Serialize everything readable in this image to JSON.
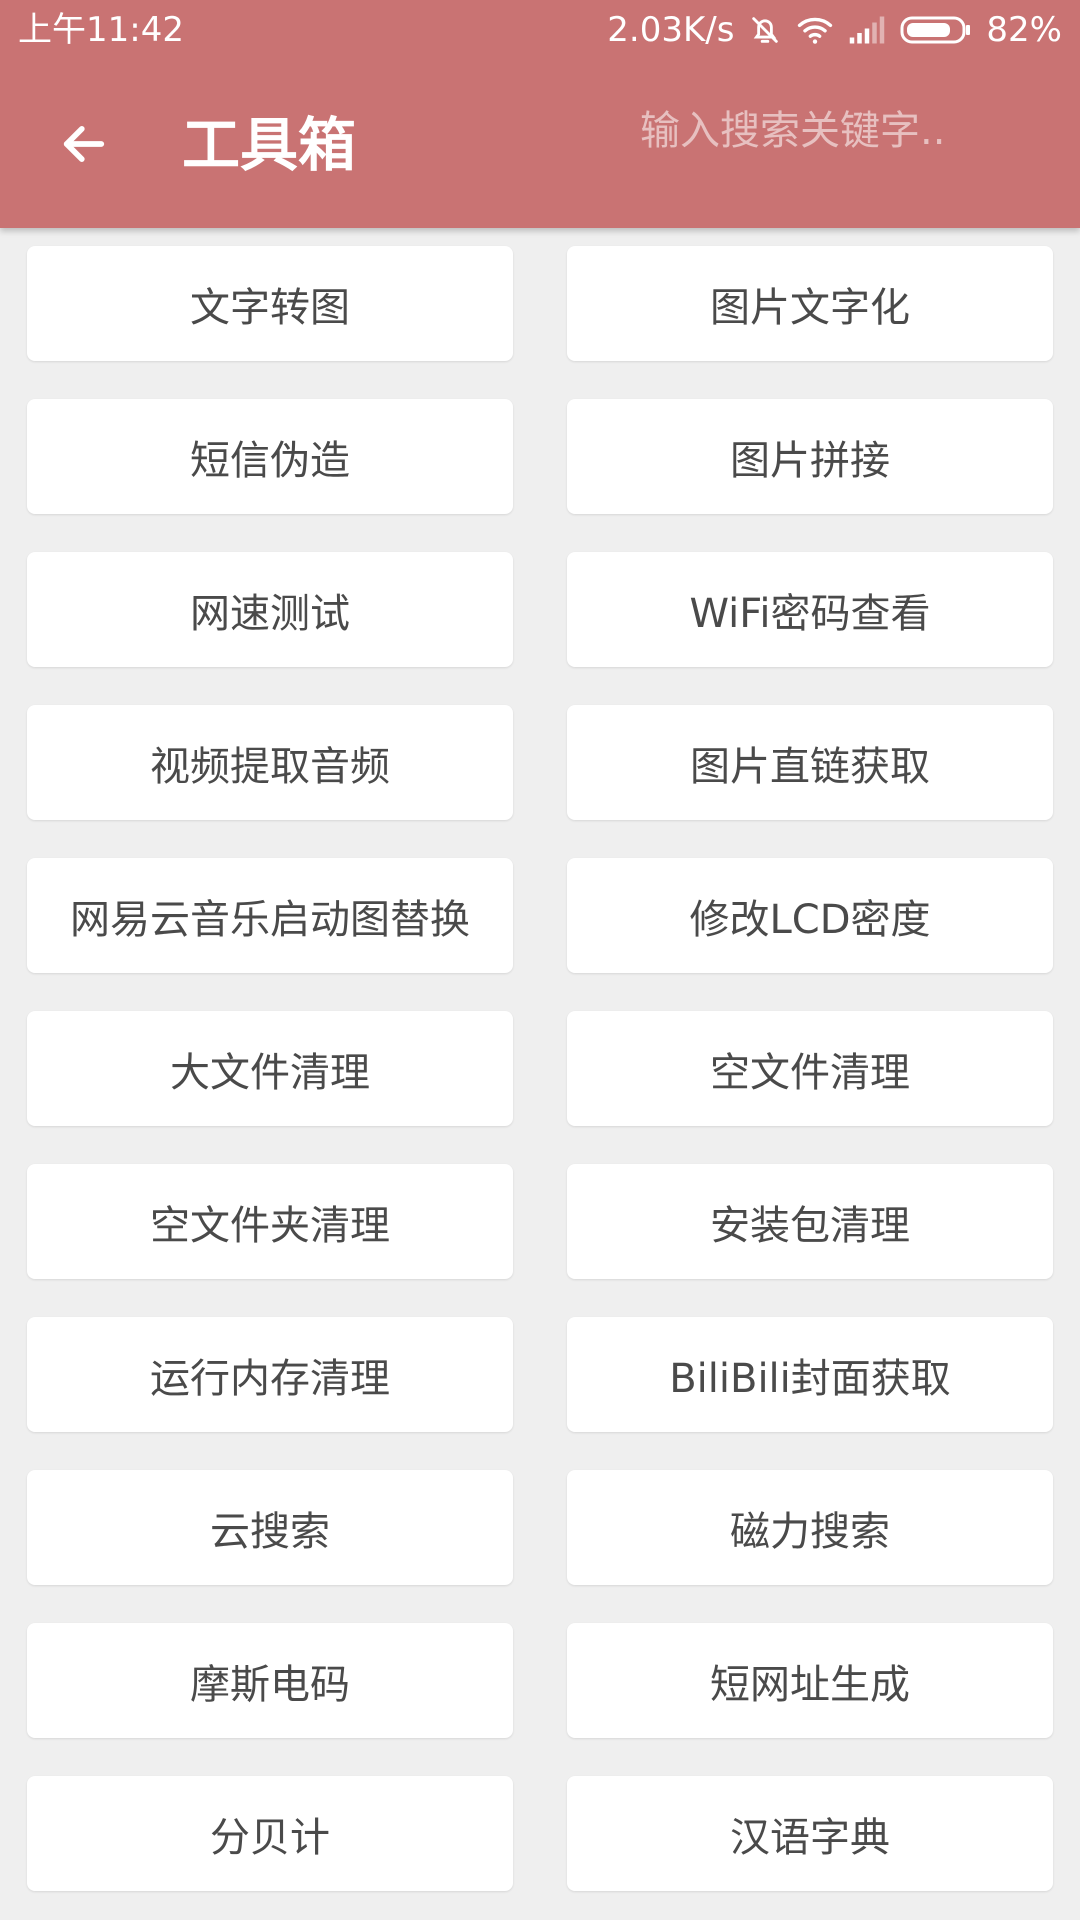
{
  "status_bar": {
    "time": "上午11:42",
    "network_speed": "2.03K/s",
    "battery_percent": "82%",
    "battery_level": 0.82,
    "icons": [
      "bell-off-icon",
      "wifi-icon",
      "signal-icon",
      "battery-icon"
    ]
  },
  "app_bar": {
    "title": "工具箱",
    "search_placeholder": "输入搜索关键字..",
    "search_value": "",
    "back_icon": "arrow-left-icon"
  },
  "colors": {
    "primary": "#c97373",
    "background": "#efefef",
    "card": "#ffffff",
    "text": "#4a4a4a"
  },
  "tools": [
    "文字转图",
    "图片文字化",
    "短信伪造",
    "图片拼接",
    "网速测试",
    "WiFi密码查看",
    "视频提取音频",
    "图片直链获取",
    "网易云音乐启动图替换",
    "修改LCD密度",
    "大文件清理",
    "空文件清理",
    "空文件夹清理",
    "安装包清理",
    "运行内存清理",
    "BiliBili封面获取",
    "云搜索",
    "磁力搜索",
    "摩斯电码",
    "短网址生成",
    "分贝计",
    "汉语字典"
  ]
}
